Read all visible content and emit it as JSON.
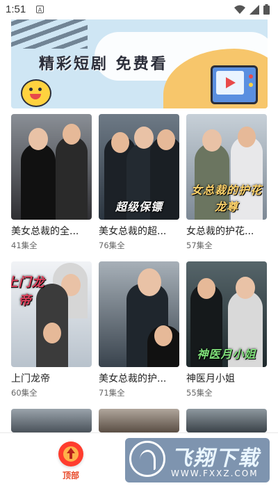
{
  "status_bar": {
    "time": "1:51",
    "notification_icon": "a-icon",
    "right_icons": [
      "wifi-icon",
      "cellular-icon",
      "battery-icon"
    ]
  },
  "banner": {
    "title": "精彩短剧 免费看",
    "icons": [
      "smiley-icon",
      "tv-play-icon"
    ]
  },
  "dramas": [
    {
      "title": "美女总裁的全...",
      "episodes": "41集全",
      "overlay": "",
      "colors": [
        "#2f2f33",
        "#d9d2c8"
      ]
    },
    {
      "title": "美女总裁的超...",
      "episodes": "76集全",
      "overlay": "超级保镖",
      "colors": [
        "#3a4552",
        "#c9ced6"
      ]
    },
    {
      "title": "女总裁的护花...",
      "episodes": "57集全",
      "overlay": "女总裁的护花龙尊",
      "colors": [
        "#8c9aa8",
        "#e2e6ea"
      ]
    },
    {
      "title": "上门龙帝",
      "episodes": "60集全",
      "overlay": "上门龙帝",
      "colors": [
        "#e9ecf1",
        "#9aa6b4"
      ]
    },
    {
      "title": "美女总裁的护...",
      "episodes": "71集全",
      "overlay": "",
      "colors": [
        "#46515c",
        "#b9c1c9"
      ]
    },
    {
      "title": "神医月小姐",
      "episodes": "55集全",
      "overlay": "神医月小姐",
      "colors": [
        "#2f3b3e",
        "#8fa3a6"
      ]
    }
  ],
  "bottom": {
    "top_button_label": "顶部",
    "watermark_brand": "飞翔下载",
    "watermark_site": "WWW.FXXZ.COM"
  }
}
